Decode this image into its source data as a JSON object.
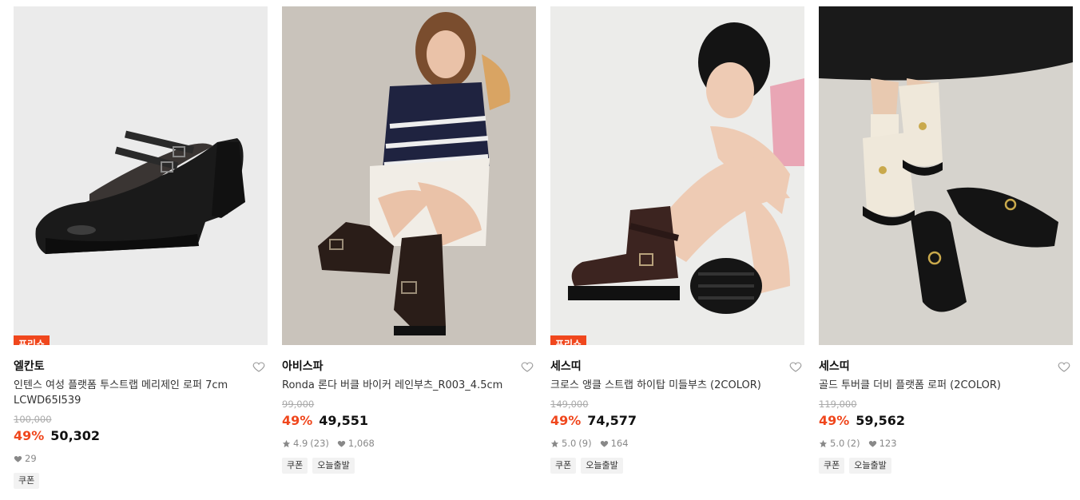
{
  "products": [
    {
      "badge": "프리쇼",
      "brand": "엘칸토",
      "title": "인텐스 여성 플랫폼 투스트랩 메리제인 로퍼 7cm LCWD65I539",
      "original_price": "100,000",
      "discount": "49%",
      "price": "50,302",
      "rating": "",
      "reviews": "",
      "likes": "29",
      "tags": [
        "쿠폰"
      ]
    },
    {
      "badge": "",
      "brand": "아비스파",
      "title": "Ronda 론다 버클 바이커 레인부츠_R003_4.5cm",
      "original_price": "99,000",
      "discount": "49%",
      "price": "49,551",
      "rating": "4.9",
      "reviews": "(23)",
      "likes": "1,068",
      "tags": [
        "쿠폰",
        "오늘출발"
      ]
    },
    {
      "badge": "프리쇼",
      "brand": "세스띠",
      "title": "크로스 앵클 스트랩 하이탑 미들부츠 (2COLOR)",
      "original_price": "149,000",
      "discount": "49%",
      "price": "74,577",
      "rating": "5.0",
      "reviews": "(9)",
      "likes": "164",
      "tags": [
        "쿠폰",
        "오늘출발"
      ]
    },
    {
      "badge": "",
      "brand": "세스띠",
      "title": "골드 투버클 더비 플랫폼 로퍼 (2COLOR)",
      "original_price": "119,000",
      "discount": "49%",
      "price": "59,562",
      "rating": "5.0",
      "reviews": "(2)",
      "likes": "123",
      "tags": [
        "쿠폰",
        "오늘출발"
      ]
    }
  ],
  "colors": {
    "accent": "#f0471d",
    "muted": "#888888"
  }
}
